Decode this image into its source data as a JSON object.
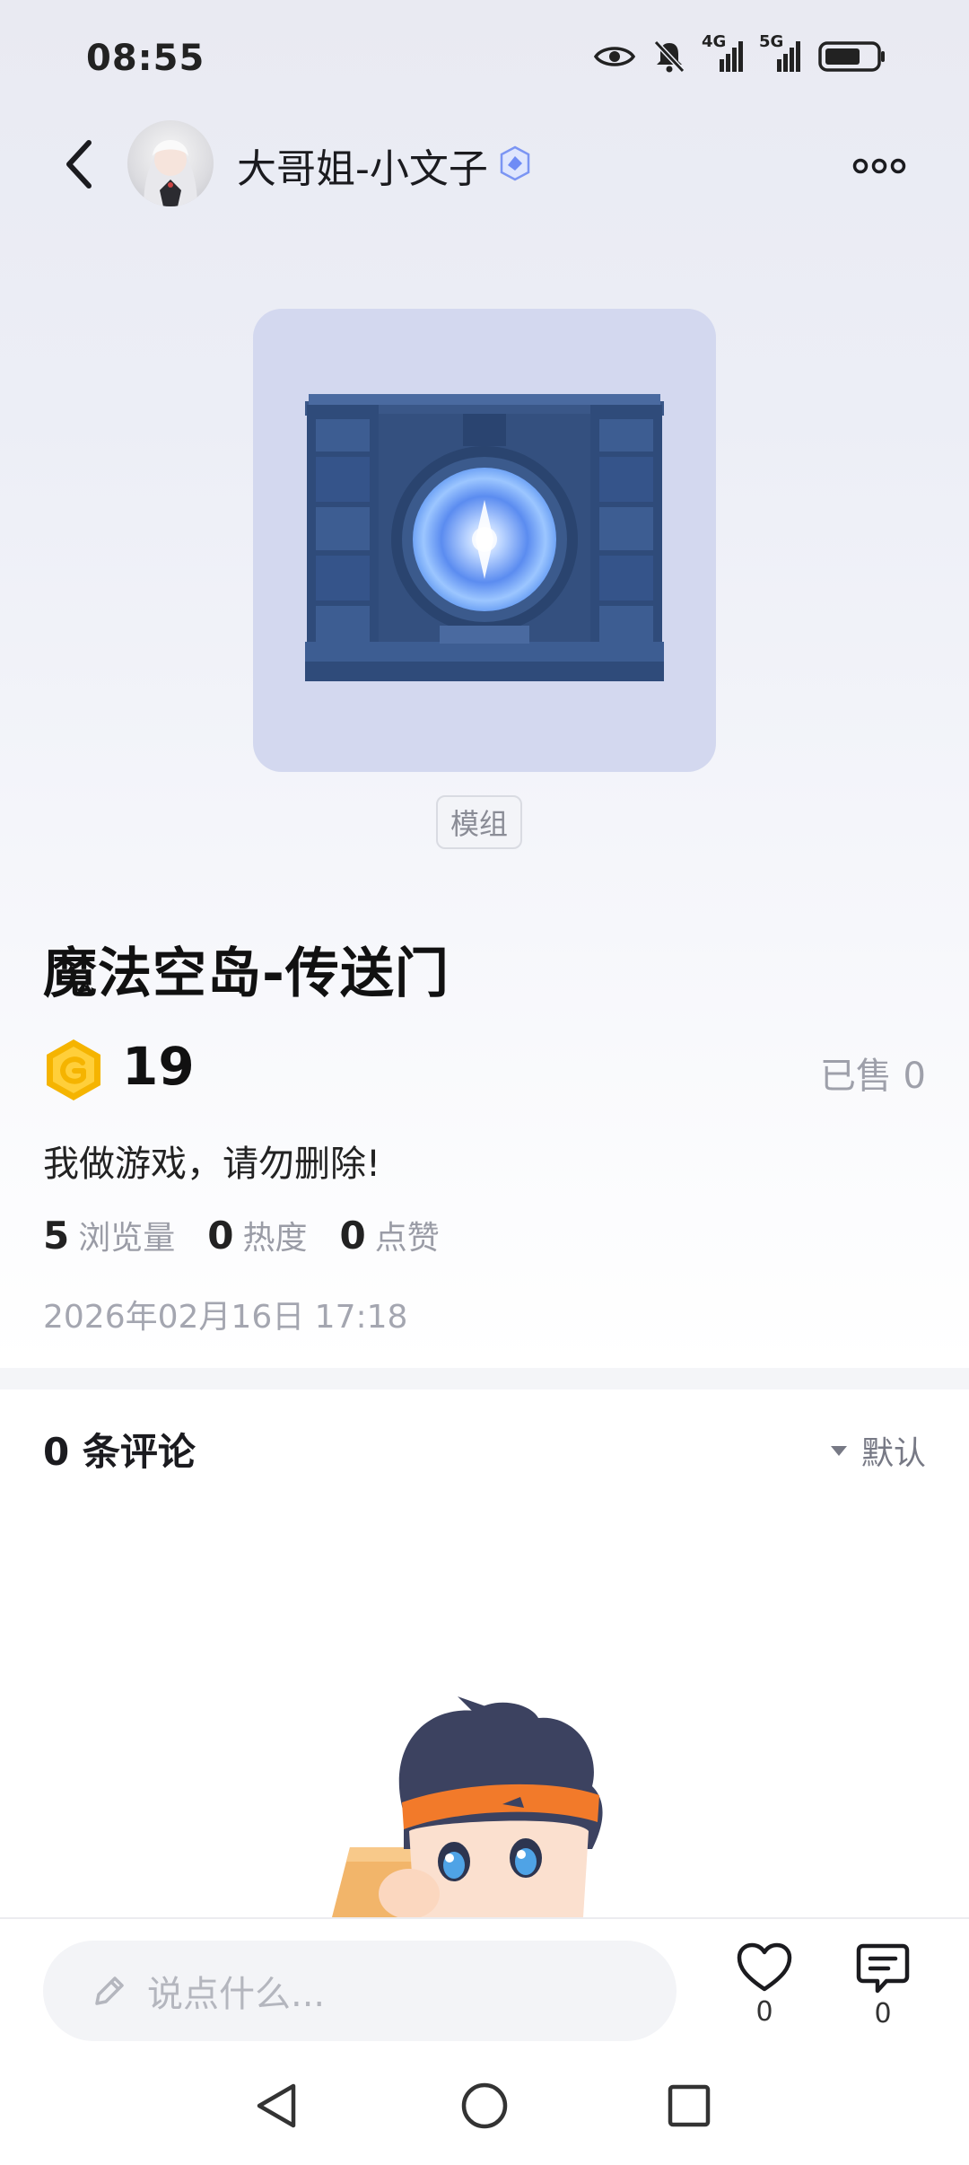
{
  "status_bar": {
    "time": "08:55",
    "network_1": "4G",
    "network_2": "5G"
  },
  "header": {
    "author_name": "大哥姐-小文子",
    "more_label": "more"
  },
  "product": {
    "tag": "模组",
    "title": "魔法空岛-传送门",
    "price": "19",
    "sold": "已售 0",
    "description": "我做游戏，请勿删除!",
    "stats": [
      {
        "value": "5",
        "label": "浏览量"
      },
      {
        "value": "0",
        "label": "热度"
      },
      {
        "value": "0",
        "label": "点赞"
      }
    ],
    "date": "2026年02月16日 17:18"
  },
  "comments": {
    "count_label": "0 条评论",
    "sort_label": "默认"
  },
  "bottom_bar": {
    "input_placeholder": "说点什么...",
    "like_count": "0",
    "comment_count": "0"
  },
  "colors": {
    "accent_gold": "#f5b400",
    "verified_blue": "#6f8cf5",
    "portal_blue": "#3b5a8c"
  },
  "icons": [
    "back-icon",
    "eye-icon",
    "mute-bell-icon",
    "signal-icon",
    "battery-icon",
    "verified-icon",
    "more-icon",
    "coin-icon",
    "sort-triangle-icon",
    "pencil-icon",
    "heart-icon",
    "comment-icon",
    "nav-back-icon",
    "nav-home-icon",
    "nav-recent-icon"
  ]
}
